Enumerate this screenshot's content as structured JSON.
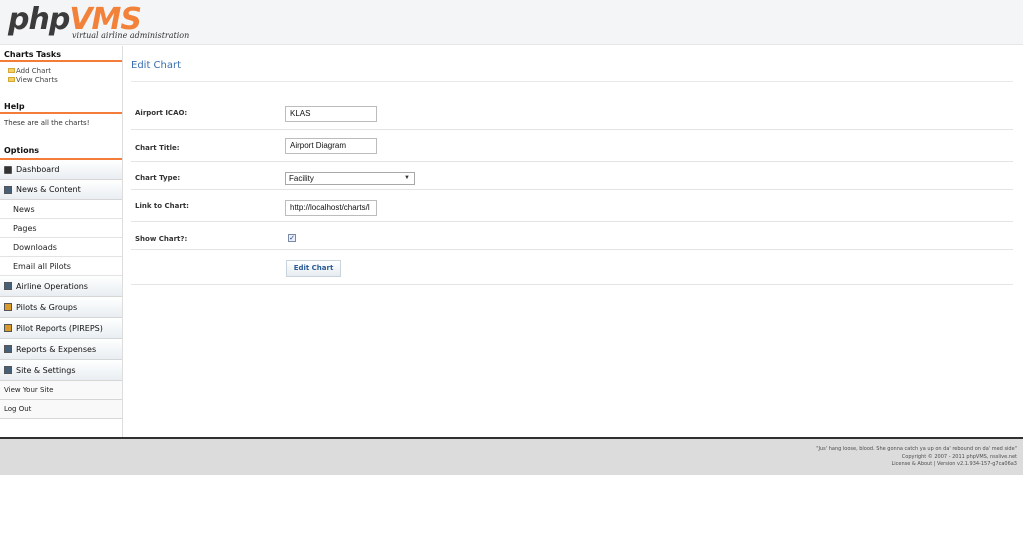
{
  "header": {
    "logo_php": "php",
    "logo_vms": "VMS",
    "tagline": "virtual airline administration"
  },
  "sidebar": {
    "tasks_title": "Charts Tasks",
    "tasks": [
      {
        "label": "Add Chart",
        "icon": "folder-icon"
      },
      {
        "label": "View Charts",
        "icon": "folder-icon"
      }
    ],
    "help_title": "Help",
    "help_text": "These are all the charts!",
    "options_title": "Options",
    "options": {
      "dashboard": "Dashboard",
      "news_content": "News & Content",
      "news": "News",
      "pages": "Pages",
      "downloads": "Downloads",
      "email_pilots": "Email all Pilots",
      "airline_operations": "Airline Operations",
      "pilots_groups": "Pilots & Groups",
      "pilot_reports": "Pilot Reports (PIREPS)",
      "reports_expenses": "Reports & Expenses",
      "site_settings": "Site & Settings",
      "view_site": "View Your Site",
      "log_out": "Log Out"
    }
  },
  "main": {
    "title": "Edit Chart",
    "form": {
      "airport_label": "Airport ICAO:",
      "airport_value": "KLAS",
      "title_label": "Chart Title:",
      "title_value": "Airport Diagram",
      "type_label": "Chart Type:",
      "type_value": "Facility",
      "link_label": "Link to Chart:",
      "link_value": "http://localhost/charts/l",
      "show_label": "Show Chart?:",
      "show_checked": true,
      "submit_label": "Edit Chart"
    }
  },
  "footer": {
    "quote": "\"Jus' hang loose, blood. She gonna catch ya up on da' rebound on da' med side\"",
    "copyright": "Copyright © 2007 - 2011 phpVMS, nsslive.net",
    "version": "License & About | Version v2.1.934-157-g7ca06a3"
  },
  "colors": {
    "accent_orange": "#f37c3a",
    "title_blue": "#3a6fae",
    "footer_bg": "#dcdcdc"
  }
}
